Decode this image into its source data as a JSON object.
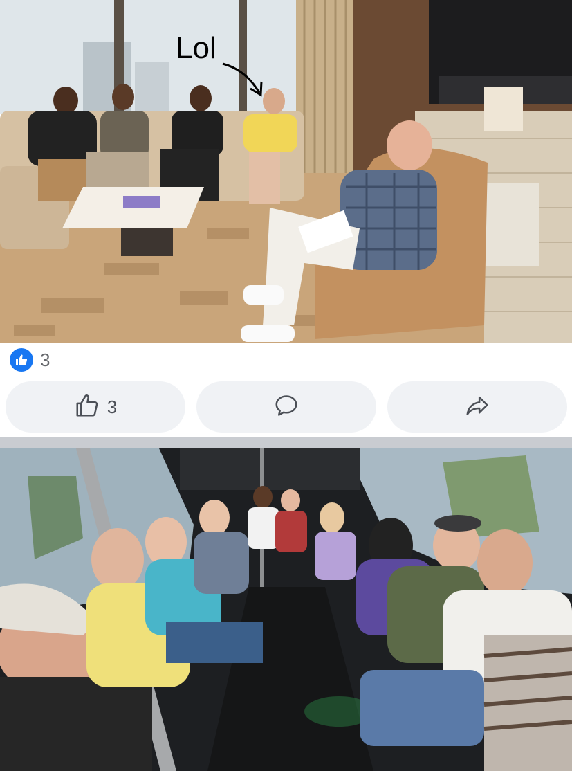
{
  "post1": {
    "annotation": "Lol"
  },
  "reactions": {
    "count": "3"
  },
  "actions": {
    "like_count": "3"
  },
  "icons": {
    "reaction": "thumbs-up-icon",
    "like": "thumbs-up-outline-icon",
    "comment": "comment-bubble-icon",
    "share": "share-arrow-icon"
  },
  "colors": {
    "like_blue": "#1877f2",
    "button_bg": "#f0f2f5",
    "icon_gray": "#4b4f56"
  }
}
